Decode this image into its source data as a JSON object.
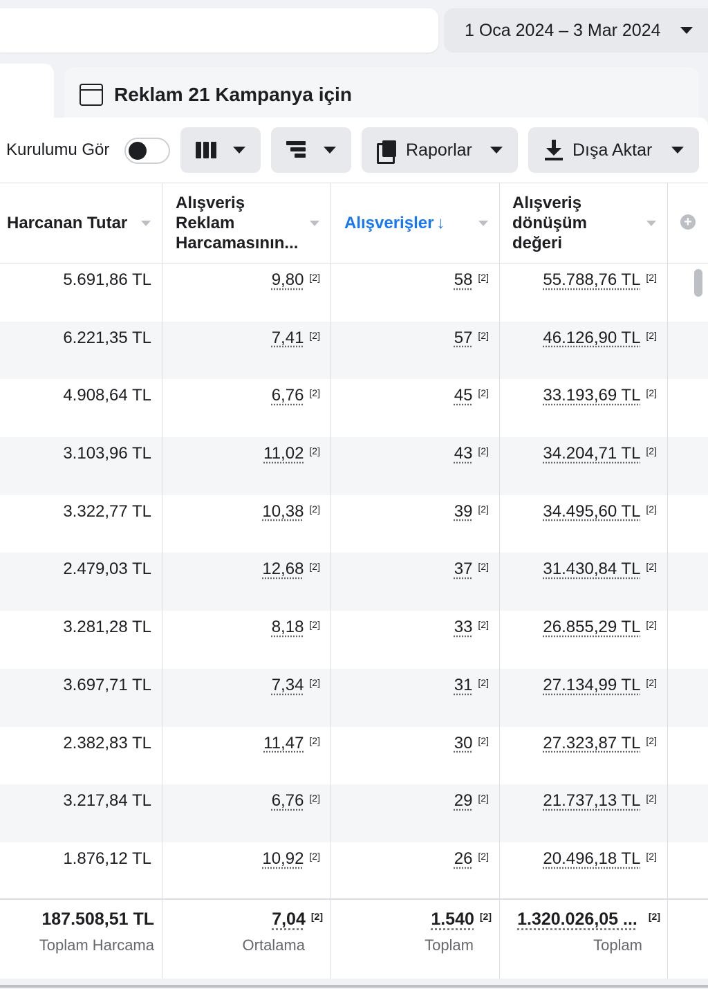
{
  "date_range": {
    "label": "1 Oca 2024 – 3 Mar 2024"
  },
  "tab": {
    "title": "Reklam 21 Kampanya için"
  },
  "toolbar": {
    "toggle_label": "Kurulumu Gör",
    "reports_label": "Raporlar",
    "export_label": "Dışa Aktar"
  },
  "columns": {
    "spend": "Harcanan Tutar",
    "cost_per_purchase_l1": "Alışveriş",
    "cost_per_purchase_l2": "Reklam",
    "cost_per_purchase_l3": "Harcamasının...",
    "purchases": "Alışverişler",
    "conv_value_l1": "Alışveriş",
    "conv_value_l2": "dönüşüm",
    "conv_value_l3": "değeri"
  },
  "footnote": "[2]",
  "rows": [
    {
      "spend": "5.691,86 TL",
      "cpp": "9,80",
      "purchases": "58",
      "value": "55.788,76 TL"
    },
    {
      "spend": "6.221,35 TL",
      "cpp": "7,41",
      "purchases": "57",
      "value": "46.126,90 TL"
    },
    {
      "spend": "4.908,64 TL",
      "cpp": "6,76",
      "purchases": "45",
      "value": "33.193,69 TL"
    },
    {
      "spend": "3.103,96 TL",
      "cpp": "11,02",
      "purchases": "43",
      "value": "34.204,71 TL"
    },
    {
      "spend": "3.322,77 TL",
      "cpp": "10,38",
      "purchases": "39",
      "value": "34.495,60 TL"
    },
    {
      "spend": "2.479,03 TL",
      "cpp": "12,68",
      "purchases": "37",
      "value": "31.430,84 TL"
    },
    {
      "spend": "3.281,28 TL",
      "cpp": "8,18",
      "purchases": "33",
      "value": "26.855,29 TL"
    },
    {
      "spend": "3.697,71 TL",
      "cpp": "7,34",
      "purchases": "31",
      "value": "27.134,99 TL"
    },
    {
      "spend": "2.382,83 TL",
      "cpp": "11,47",
      "purchases": "30",
      "value": "27.323,87 TL"
    },
    {
      "spend": "3.217,84 TL",
      "cpp": "6,76",
      "purchases": "29",
      "value": "21.737,13 TL"
    },
    {
      "spend": "1.876,12 TL",
      "cpp": "10,92",
      "purchases": "26",
      "value": "20.496,18 TL"
    }
  ],
  "totals": {
    "spend": "187.508,51 TL",
    "spend_sub": "Toplam Harcama",
    "cpp": "7,04",
    "cpp_sub": "Ortalama",
    "purchases": "1.540",
    "purchases_sub": "Toplam",
    "value": "1.320.026,05 ...",
    "value_sub": "Toplam"
  }
}
